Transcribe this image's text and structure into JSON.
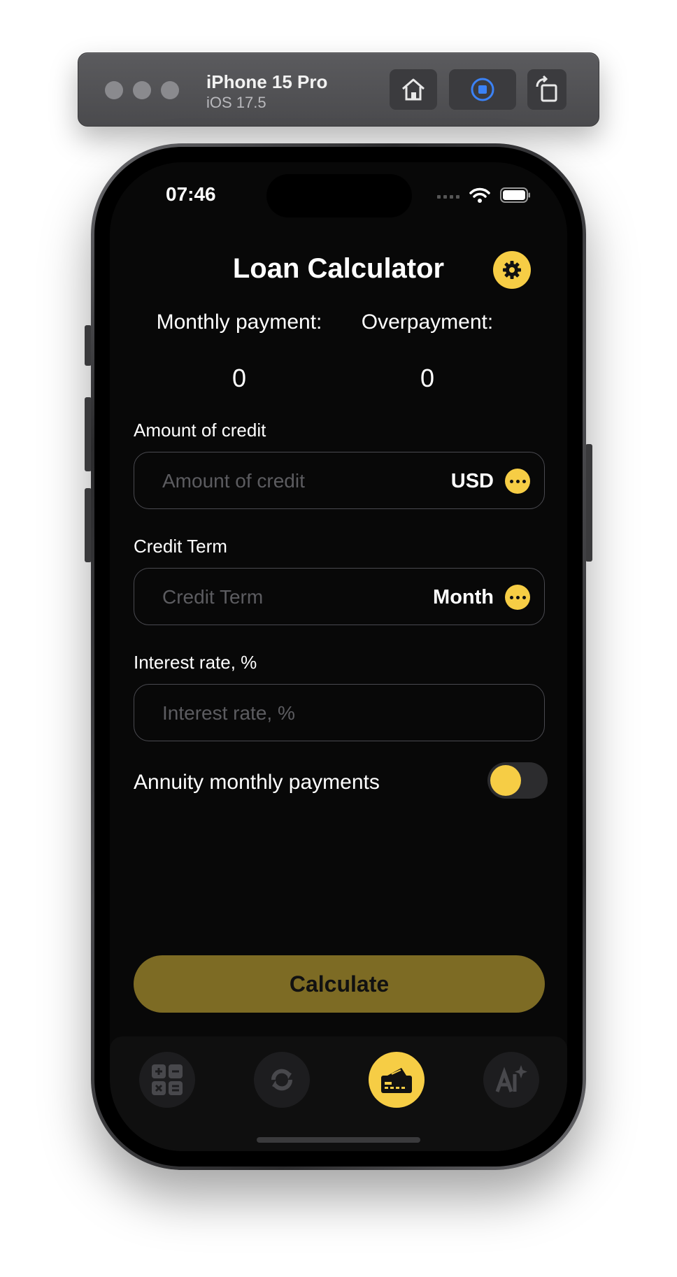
{
  "simulator": {
    "device_name": "iPhone 15 Pro",
    "os_version": "iOS 17.5",
    "icons": [
      "home-icon",
      "screenshot-record-icon",
      "rotate-icon"
    ]
  },
  "status_bar": {
    "time": "07:46",
    "icons": [
      "cellular-icon",
      "wifi-icon",
      "battery-icon"
    ]
  },
  "header": {
    "title": "Loan Calculator",
    "settings_icon": "gear-icon"
  },
  "summary": {
    "monthly_payment_label": "Monthly payment:",
    "monthly_payment_value": "0",
    "overpayment_label": "Overpayment:",
    "overpayment_value": "0"
  },
  "form": {
    "amount": {
      "label": "Amount of credit",
      "placeholder": "Amount of credit",
      "value": "",
      "unit": "USD"
    },
    "term": {
      "label": "Credit Term",
      "placeholder": "Credit Term",
      "value": "",
      "unit": "Month"
    },
    "rate": {
      "label": "Interest rate, %",
      "placeholder": "Interest rate, %",
      "value": ""
    },
    "annuity": {
      "label": "Annuity monthly payments",
      "enabled": false
    }
  },
  "actions": {
    "calculate_label": "Calculate"
  },
  "tabbar": {
    "items": [
      {
        "name": "calculator",
        "icon": "calculator-icon",
        "active": false
      },
      {
        "name": "converter",
        "icon": "refresh-icon",
        "active": false
      },
      {
        "name": "loan",
        "icon": "credit-card-icon",
        "active": true
      },
      {
        "name": "ai",
        "icon": "ai-sparkle-icon",
        "active": false
      }
    ]
  },
  "colors": {
    "accent": "#f6cd45",
    "accent_dim": "#7d6b24",
    "background": "#080808",
    "field_border": "#4a4a50",
    "placeholder": "#5c5c60"
  }
}
